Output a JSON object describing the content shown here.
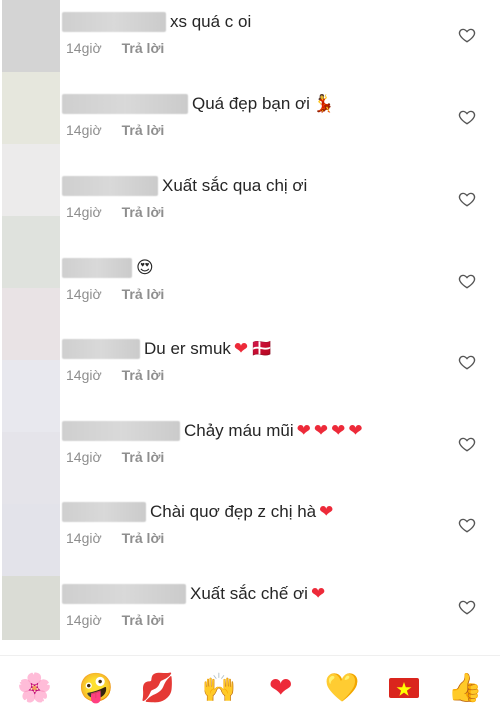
{
  "comments": [
    {
      "text": "xs quá c oi",
      "emoji": [],
      "time": "14giờ",
      "reply": "Trả lời"
    },
    {
      "text": "Quá đẹp bạn ơi",
      "emoji": [
        "💃"
      ],
      "time": "14giờ",
      "reply": "Trả lời"
    },
    {
      "text": "Xuất sắc qua chị ơi",
      "emoji": [],
      "time": "14giờ",
      "reply": "Trả lời"
    },
    {
      "text": "",
      "emoji": [
        "😍"
      ],
      "time": "14giờ",
      "reply": "Trả lời"
    },
    {
      "text": "Du er smuk",
      "emoji": [
        "❤",
        "🇩🇰"
      ],
      "time": "14giờ",
      "reply": "Trả lời"
    },
    {
      "text": "Chảy máu mũi",
      "emoji": [
        "❤",
        "❤",
        "❤",
        "❤"
      ],
      "time": "14giờ",
      "reply": "Trả lời"
    },
    {
      "text": "Chài quơ đẹp z chị hà",
      "emoji": [
        "❤"
      ],
      "time": "14giờ",
      "reply": "Trả lời"
    },
    {
      "text": "Xuất sắc chế ơi",
      "emoji": [
        "❤"
      ],
      "time": "14giờ",
      "reply": "Trả lời"
    }
  ],
  "reactions": [
    {
      "icon": "cherry-blossom",
      "glyph": "🌸"
    },
    {
      "icon": "zany-face",
      "glyph": "🤪"
    },
    {
      "icon": "kiss-mark",
      "glyph": "💋"
    },
    {
      "icon": "raising-hands",
      "glyph": "🙌"
    },
    {
      "icon": "red-heart",
      "glyph": "❤"
    },
    {
      "icon": "yellow-heart",
      "glyph": "💛"
    },
    {
      "icon": "vietnam-flag",
      "glyph": "🇻🇳"
    },
    {
      "icon": "thumbs-up",
      "glyph": "👍"
    }
  ],
  "colors": {
    "text": "#262626",
    "meta": "#8e8e8e",
    "heart_red": "#ed2a39",
    "outline": "#555555"
  }
}
